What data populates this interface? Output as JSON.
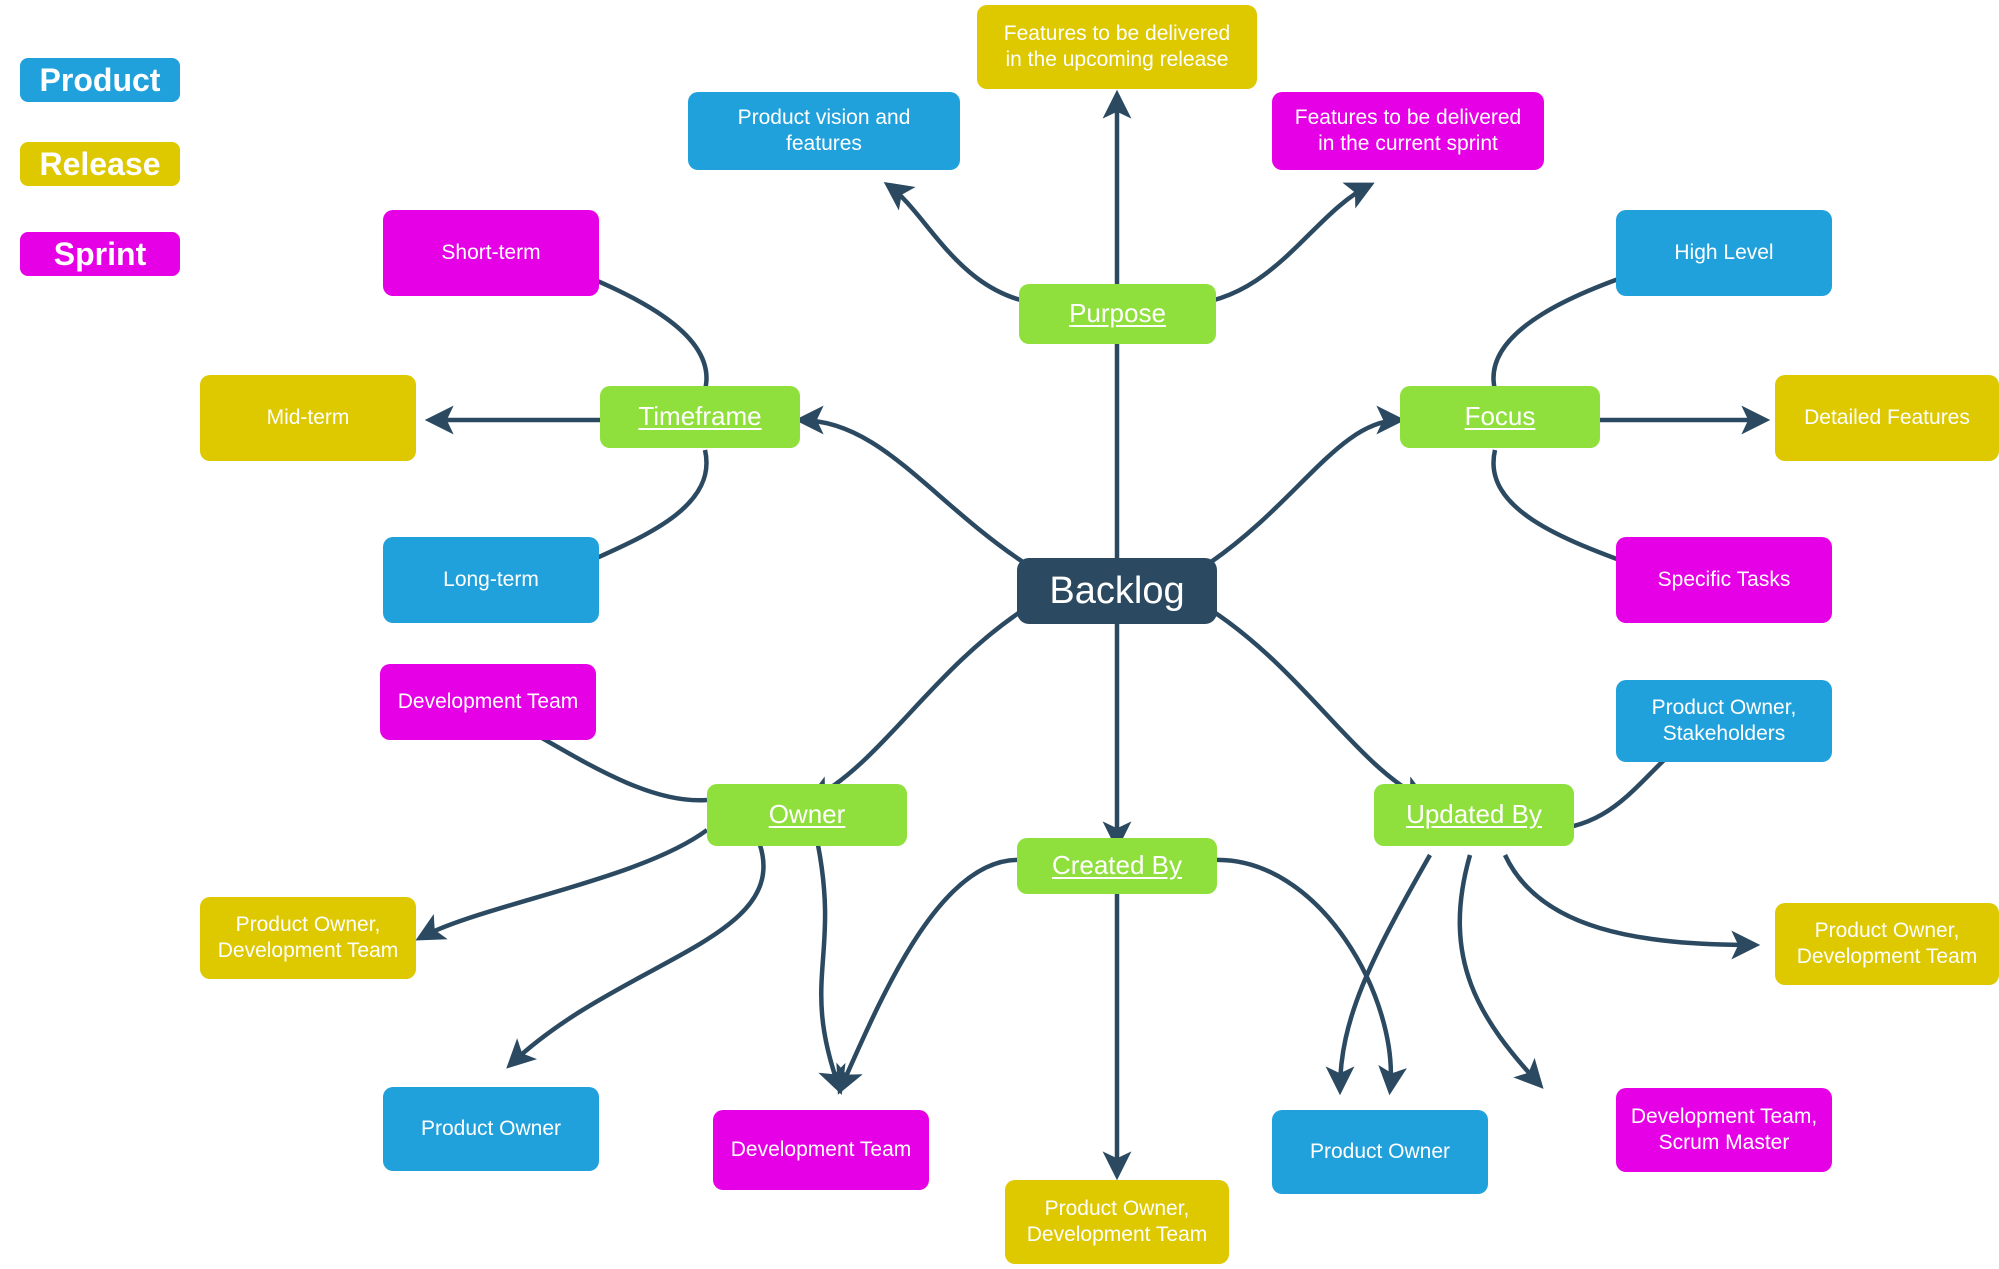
{
  "colors": {
    "product": "#21a1db",
    "release": "#dec800",
    "sprint": "#e600e6",
    "branch": "#8fe03c",
    "root": "#2b4a61",
    "edge": "#2b4a61",
    "text": "#ffffff",
    "background": "#ffffff"
  },
  "legend": {
    "title": "Backlog type legend",
    "items": [
      {
        "label": "Product",
        "color_key": "product"
      },
      {
        "label": "Release",
        "color_key": "release"
      },
      {
        "label": "Sprint",
        "color_key": "sprint"
      }
    ]
  },
  "root": {
    "label": "Backlog"
  },
  "branches": [
    {
      "id": "purpose",
      "label": "Purpose"
    },
    {
      "id": "timeframe",
      "label": "Timeframe"
    },
    {
      "id": "focus",
      "label": "Focus"
    },
    {
      "id": "owner",
      "label": "Owner"
    },
    {
      "id": "created_by",
      "label": "Created By"
    },
    {
      "id": "updated_by",
      "label": "Updated By"
    }
  ],
  "leaves": {
    "purpose": [
      {
        "label": "Product vision and\nfeatures",
        "type": "product"
      },
      {
        "label": "Features to be delivered\nin the upcoming release",
        "type": "release"
      },
      {
        "label": "Features to be delivered\nin the current sprint",
        "type": "sprint"
      }
    ],
    "timeframe": [
      {
        "label": "Long-term",
        "type": "product"
      },
      {
        "label": "Mid-term",
        "type": "release"
      },
      {
        "label": "Short-term",
        "type": "sprint"
      }
    ],
    "focus": [
      {
        "label": "High Level",
        "type": "product"
      },
      {
        "label": "Detailed Features",
        "type": "release"
      },
      {
        "label": "Specific Tasks",
        "type": "sprint"
      }
    ],
    "owner": [
      {
        "label": "Product Owner",
        "type": "product"
      },
      {
        "label": "Product Owner,\nDevelopment Team",
        "type": "release"
      },
      {
        "label": "Development Team",
        "type": "sprint"
      }
    ],
    "created_by": [
      {
        "label": "Product Owner",
        "type": "product"
      },
      {
        "label": "Product Owner,\nDevelopment Team",
        "type": "release"
      },
      {
        "label": "Development Team",
        "type": "sprint"
      }
    ],
    "updated_by": [
      {
        "label": "Product Owner,\nStakeholders",
        "type": "product"
      },
      {
        "label": "Product Owner,\nDevelopment Team",
        "type": "release"
      },
      {
        "label": "Development Team,\nScrum Master",
        "type": "sprint"
      }
    ]
  },
  "chart_data": {
    "type": "diagram",
    "diagram_kind": "mind-map",
    "title": "Backlog",
    "center": "Backlog",
    "categories": [
      "Product",
      "Release",
      "Sprint"
    ],
    "category_colors": {
      "Product": "#21a1db",
      "Release": "#dec800",
      "Sprint": "#e600e6"
    },
    "branches": [
      {
        "name": "Purpose",
        "values": {
          "Product": "Product vision and features",
          "Release": "Features to be delivered in the upcoming release",
          "Sprint": "Features to be delivered in the current sprint"
        }
      },
      {
        "name": "Timeframe",
        "values": {
          "Product": "Long-term",
          "Release": "Mid-term",
          "Sprint": "Short-term"
        }
      },
      {
        "name": "Focus",
        "values": {
          "Product": "High Level",
          "Release": "Detailed Features",
          "Sprint": "Specific Tasks"
        }
      },
      {
        "name": "Owner",
        "values": {
          "Product": "Product Owner",
          "Release": "Product Owner, Development Team",
          "Sprint": "Development Team"
        }
      },
      {
        "name": "Created By",
        "values": {
          "Product": "Product Owner",
          "Release": "Product Owner, Development Team",
          "Sprint": "Development Team"
        }
      },
      {
        "name": "Updated By",
        "values": {
          "Product": "Product Owner, Stakeholders",
          "Release": "Product Owner, Development Team",
          "Sprint": "Development Team, Scrum Master"
        }
      }
    ]
  }
}
